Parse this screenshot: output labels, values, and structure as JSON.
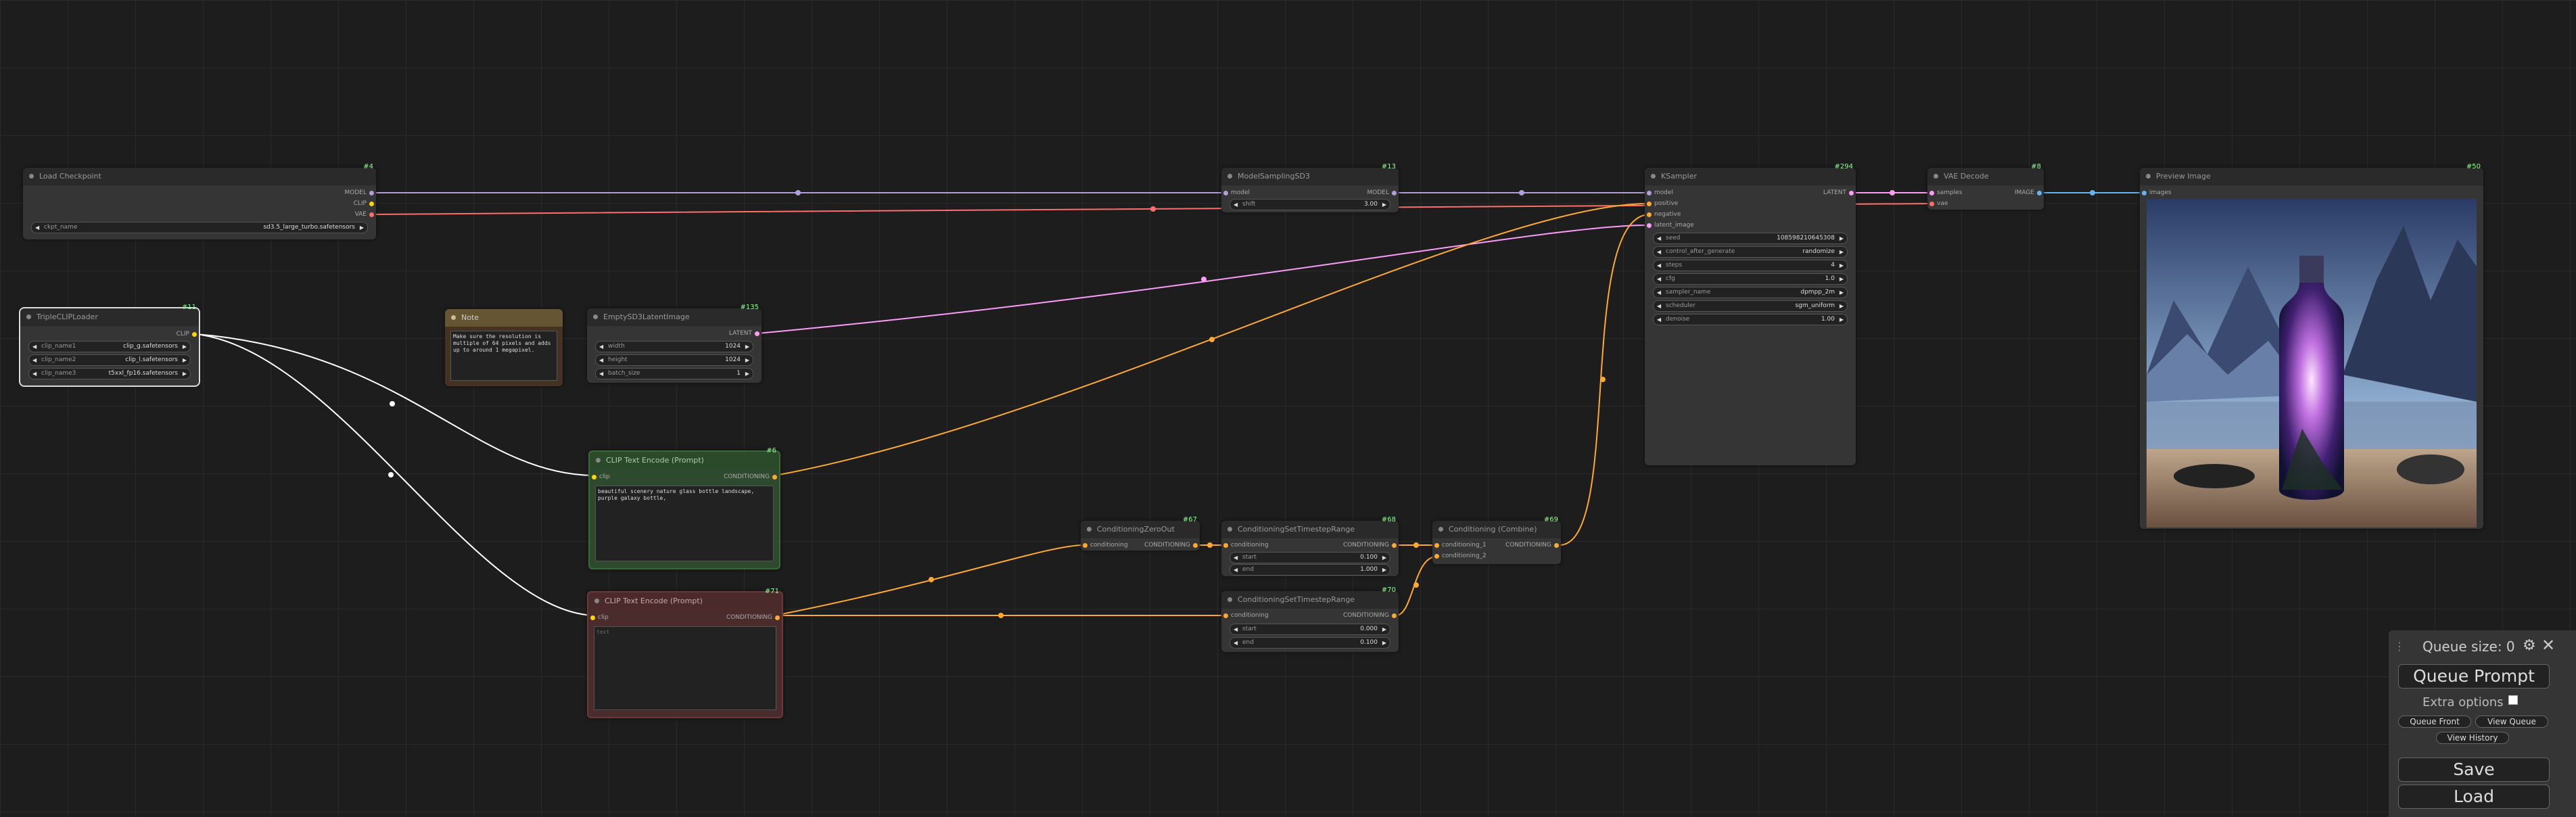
{
  "nodes": {
    "load_checkpoint": {
      "title": "Load Checkpoint",
      "id": "#4",
      "out": [
        "MODEL",
        "CLIP",
        "VAE"
      ],
      "widget": {
        "label": "ckpt_name",
        "value": "sd3.5_large_turbo.safetensors"
      }
    },
    "triple_clip": {
      "title": "TripleCLIPLoader",
      "id": "#11",
      "out": "CLIP",
      "widgets": [
        {
          "label": "clip_name1",
          "value": "clip_g.safetensors"
        },
        {
          "label": "clip_name2",
          "value": "clip_l.safetensors"
        },
        {
          "label": "clip_name3",
          "value": "t5xxl_fp16.safetensors"
        }
      ]
    },
    "note": {
      "title": "Note",
      "text": "Make sure the resolution is\nmultiple of 64 pixels and adds\nup to around 1 megapixel."
    },
    "empty_latent": {
      "title": "EmptySD3LatentImage",
      "id": "#135",
      "out": "LATENT",
      "widgets": [
        {
          "label": "width",
          "value": "1024"
        },
        {
          "label": "height",
          "value": "1024"
        },
        {
          "label": "batch_size",
          "value": "1"
        }
      ]
    },
    "clip_pos": {
      "title": "CLIP Text Encode (Prompt)",
      "id": "#6",
      "in": "clip",
      "out": "CONDITIONING",
      "text": "beautiful scenery nature glass bottle landscape, purple galaxy bottle,"
    },
    "clip_neg": {
      "title": "CLIP Text Encode (Prompt)",
      "id": "#71",
      "in": "clip",
      "out": "CONDITIONING",
      "placeholder": "text"
    },
    "model_sampling": {
      "title": "ModelSamplingSD3",
      "id": "#13",
      "in": "model",
      "out": "MODEL",
      "widget": {
        "label": "shift",
        "value": "3.00"
      }
    },
    "ksampler": {
      "title": "KSampler",
      "id": "#294",
      "inputs": [
        "model",
        "positive",
        "negative",
        "latent_image"
      ],
      "out": "LATENT",
      "widgets": [
        {
          "label": "seed",
          "value": "108598210645308"
        },
        {
          "label": "control_after_generate",
          "value": "randomize"
        },
        {
          "label": "steps",
          "value": "4"
        },
        {
          "label": "cfg",
          "value": "1.0"
        },
        {
          "label": "sampler_name",
          "value": "dpmpp_2m"
        },
        {
          "label": "scheduler",
          "value": "sgm_uniform"
        },
        {
          "label": "denoise",
          "value": "1.00"
        }
      ]
    },
    "vae_decode": {
      "title": "VAE Decode",
      "id": "#8",
      "inputs": [
        "samples",
        "vae"
      ],
      "out": "IMAGE"
    },
    "preview": {
      "title": "Preview Image",
      "id": "#50",
      "in": "images"
    },
    "zero_out": {
      "title": "ConditioningZeroOut",
      "id": "#67",
      "in": "conditioning",
      "out": "CONDITIONING"
    },
    "range1": {
      "title": "ConditioningSetTimestepRange",
      "id": "#68",
      "in": "conditioning",
      "out": "CONDITIONING",
      "widgets": [
        {
          "label": "start",
          "value": "0.100"
        },
        {
          "label": "end",
          "value": "1.000"
        }
      ]
    },
    "range2": {
      "title": "ConditioningSetTimestepRange",
      "id": "#70",
      "in": "conditioning",
      "out": "CONDITIONING",
      "widgets": [
        {
          "label": "start",
          "value": "0.000"
        },
        {
          "label": "end",
          "value": "0.100"
        }
      ]
    },
    "combine": {
      "title": "Conditioning (Combine)",
      "id": "#69",
      "inputs": [
        "conditioning_1",
        "conditioning_2"
      ],
      "out": "CONDITIONING"
    }
  },
  "menu": {
    "queue_size": "Queue size: 0",
    "queue_prompt": "Queue Prompt",
    "extra_options": "Extra options",
    "queue_front": "Queue Front",
    "view_queue": "View Queue",
    "view_history": "View History",
    "save": "Save",
    "load": "Load"
  },
  "colors": {
    "model": "#b39ddb",
    "clip": "#ffd500",
    "vae": "#ff6e6e",
    "latent": "#ff9cf9",
    "conditioning": "#ffa931",
    "image": "#64b5f6"
  }
}
